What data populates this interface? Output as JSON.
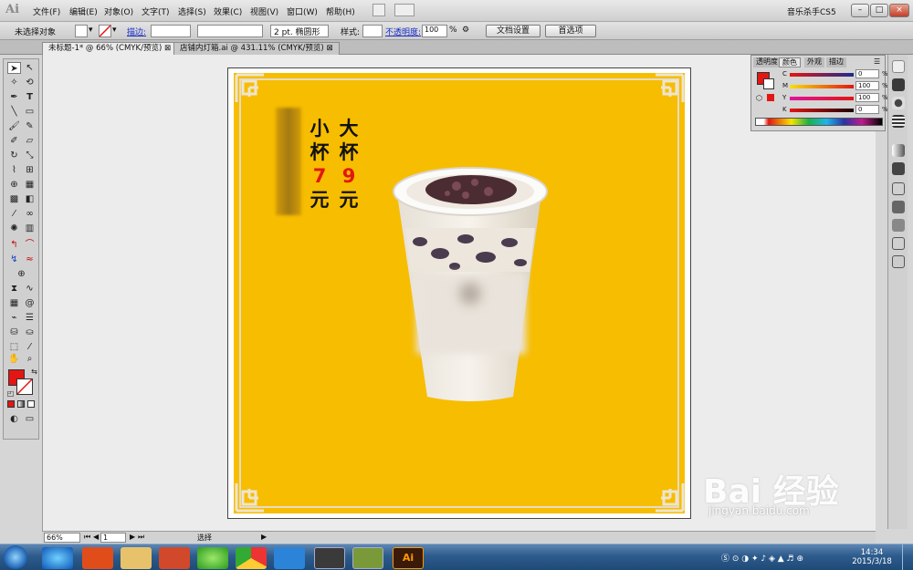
{
  "app": {
    "logo_text": "Ai"
  },
  "menu": [
    "文件(F)",
    "编辑(E)",
    "对象(O)",
    "文字(T)",
    "选择(S)",
    "效果(C)",
    "视图(V)",
    "窗口(W)",
    "帮助(H)"
  ],
  "workspace_label": "音乐杀手CS5",
  "window_buttons": [
    "–",
    "□",
    "×"
  ],
  "control": {
    "selection_label": "未选择对象",
    "fill_color": "#e31613",
    "stroke_label": "描边:",
    "stroke_value": "",
    "brush_label": "2 pt. 椭圆形",
    "style_label": "样式:",
    "opacity_label": "不透明度:",
    "opacity_value": "100",
    "opacity_unit": "%",
    "doc_setup": "文档设置",
    "preferences": "首选项"
  },
  "tabs": [
    {
      "label": "未标题-1* @ 66% (CMYK/预览)"
    },
    {
      "label": "店铺内灯箱.ai @ 431.11% (CMYK/预览)"
    }
  ],
  "artwork": {
    "background": "#f7bd00",
    "price_large": [
      "大",
      "杯",
      "9",
      "元"
    ],
    "price_small": [
      "小",
      "杯",
      "7",
      "元"
    ]
  },
  "color_panel": {
    "tabs": [
      "透明度",
      "颜色",
      "外观",
      "描边"
    ],
    "fill_swatch": "#e31613",
    "channels": [
      {
        "label": "C",
        "value": "0",
        "unit": "%"
      },
      {
        "label": "M",
        "value": "100",
        "unit": "%"
      },
      {
        "label": "Y",
        "value": "100",
        "unit": "%"
      },
      {
        "label": "K",
        "value": "0",
        "unit": "%"
      }
    ]
  },
  "status": {
    "zoom": "66%",
    "page": "1",
    "tool_label": "选择"
  },
  "taskbar": {
    "time": "14:34",
    "date": "2015/3/18",
    "ai_label": "Ai"
  },
  "watermark": {
    "brand": "Bai 经验",
    "url": "jingyan.baidu.com"
  }
}
